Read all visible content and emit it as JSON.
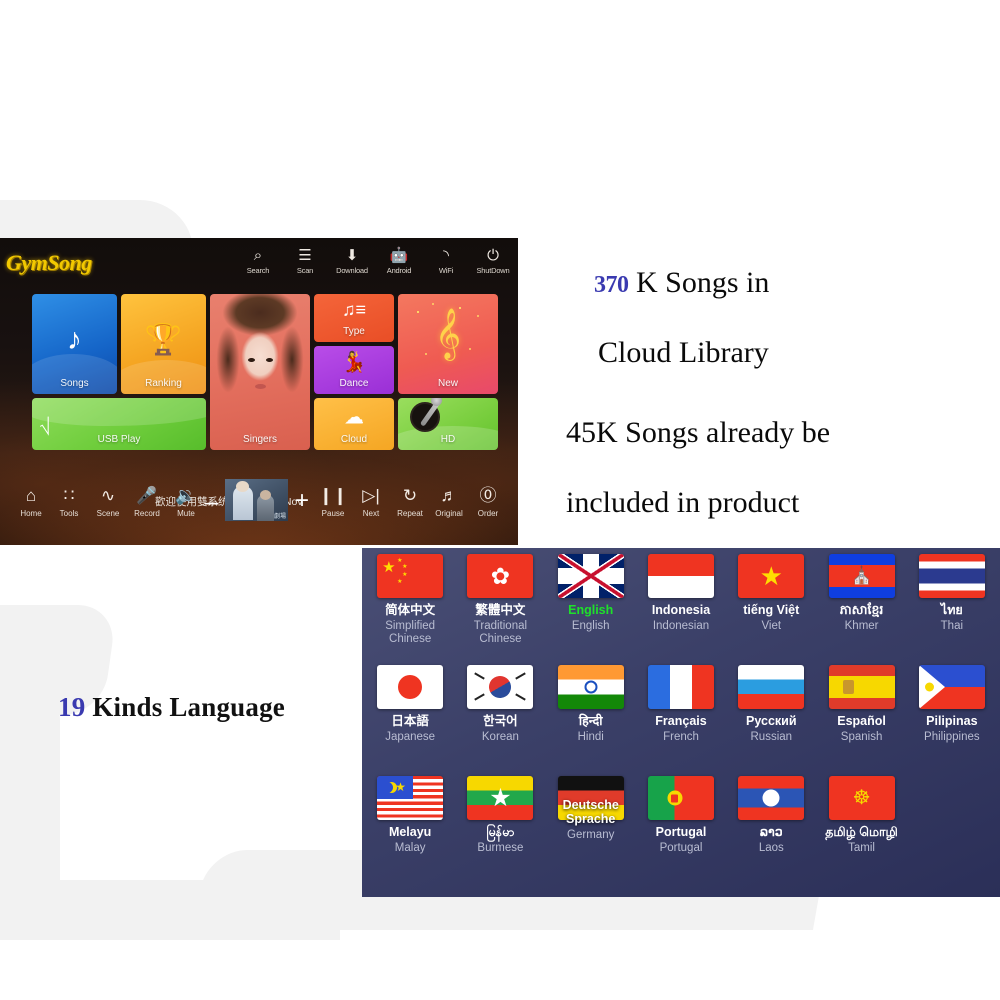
{
  "karaoke": {
    "brand": "GymSong",
    "welcome": "歡迎使用雙系统智能點歌機 Nov",
    "header_icons": [
      {
        "label": "Search",
        "icon": "search-icon",
        "glyph": "⌕"
      },
      {
        "label": "Scan",
        "icon": "scan-icon",
        "glyph": "☰"
      },
      {
        "label": "Download",
        "icon": "download-icon",
        "glyph": "⬇"
      },
      {
        "label": "Android",
        "icon": "android-icon",
        "glyph": "ᾑ6"
      },
      {
        "label": "WiFi",
        "icon": "wifi-icon",
        "glyph": "◝"
      },
      {
        "label": "ShutDown",
        "icon": "power-icon",
        "glyph": "⏻"
      }
    ],
    "tiles": [
      {
        "label": "Songs",
        "icon": "cloud-music-note-icon",
        "glyph": "♪",
        "color": "#1565c8"
      },
      {
        "label": "Ranking",
        "icon": "trophy-icon",
        "glyph": "Ἴ6",
        "color": "#f5a623"
      },
      {
        "label": "Singers",
        "icon": "singer-portrait",
        "glyph": "",
        "color": "#e4705f"
      },
      {
        "label": "Type",
        "icon": "music-list-icon",
        "glyph": "♫",
        "color": "#e94e26"
      },
      {
        "label": "Dance",
        "icon": "dancer-icon",
        "glyph": "Ὀ3",
        "color": "#9a2fd6"
      },
      {
        "label": "New",
        "icon": "treble-clef-icon",
        "glyph": "ᴑE",
        "color": "#ef5b52"
      },
      {
        "label": "USB Play",
        "icon": "usb-drive-icon",
        "glyph": "⌸",
        "color": "#6fcd3c"
      },
      {
        "label": "Cloud",
        "icon": "cloud-icon",
        "glyph": "☁",
        "color": "#f5a623"
      },
      {
        "label": "HD",
        "icon": "comedy-mic-icon",
        "glyph": "Ἲ4",
        "color": "#79ce3e"
      }
    ],
    "toolbar_left": [
      {
        "label": "Home",
        "icon": "home-icon",
        "glyph": "⌂"
      },
      {
        "label": "Tools",
        "icon": "tools-grid-icon",
        "glyph": "∷"
      },
      {
        "label": "Scene",
        "icon": "scene-icon",
        "glyph": "∿"
      },
      {
        "label": "Record",
        "icon": "microphone-icon",
        "glyph": "Ἲ4"
      },
      {
        "label": "Mute",
        "icon": "speaker-icon",
        "glyph": "ὐ9"
      }
    ],
    "toolbar_right": [
      {
        "label": "Pause",
        "icon": "pause-icon",
        "glyph": "⏸"
      },
      {
        "label": "Next",
        "icon": "next-track-icon",
        "glyph": "⏭"
      },
      {
        "label": "Repeat",
        "icon": "repeat-icon",
        "glyph": "↺"
      },
      {
        "label": "Original",
        "icon": "original-voice-icon",
        "glyph": "♬"
      },
      {
        "label": "Order",
        "icon": "order-count-icon",
        "glyph": "0"
      }
    ],
    "volume_minus": "–",
    "volume_plus": "+",
    "preview_caption": "劇場"
  },
  "marketing": {
    "line1_number": "370",
    "line1_rest": " K Songs in",
    "line2": "Cloud Library",
    "line3": "45K Songs already be",
    "line4": "included in product",
    "kinds_number": "19",
    "kinds_rest": " Kinds Language",
    "accent_color": "#3a3ab0"
  },
  "languages": [
    {
      "native": "简体中文",
      "english": "Simplified Chinese",
      "flag": "china-flag",
      "selected": false,
      "overlap": false
    },
    {
      "native": "繁體中文",
      "english": "Traditional Chinese",
      "flag": "hongkong-flag",
      "selected": false,
      "overlap": false
    },
    {
      "native": "English",
      "english": "English",
      "flag": "uk-flag",
      "selected": true,
      "overlap": false
    },
    {
      "native": "Indonesia",
      "english": "Indonesian",
      "flag": "indonesia-flag",
      "selected": false,
      "overlap": false
    },
    {
      "native": "tiếng Việt",
      "english": "Viet",
      "flag": "vietnam-flag",
      "selected": false,
      "overlap": false
    },
    {
      "native": "ភាសាខ្មែរ",
      "english": "Khmer",
      "flag": "cambodia-flag",
      "selected": false,
      "overlap": false
    },
    {
      "native": "ไทย",
      "english": "Thai",
      "flag": "thailand-flag",
      "selected": false,
      "overlap": false
    },
    {
      "native": "日本語",
      "english": "Japanese",
      "flag": "japan-flag",
      "selected": false,
      "overlap": false
    },
    {
      "native": "한국어",
      "english": "Korean",
      "flag": "korea-flag",
      "selected": false,
      "overlap": false
    },
    {
      "native": "हिन्दी",
      "english": "Hindi",
      "flag": "india-flag",
      "selected": false,
      "overlap": false
    },
    {
      "native": "Français",
      "english": "French",
      "flag": "france-flag",
      "selected": false,
      "overlap": false
    },
    {
      "native": "Русский",
      "english": "Russian",
      "flag": "russia-flag",
      "selected": false,
      "overlap": false
    },
    {
      "native": "Español",
      "english": "Spanish",
      "flag": "spain-flag",
      "selected": false,
      "overlap": false
    },
    {
      "native": "Pilipinas",
      "english": "Philippines",
      "flag": "philippines-flag",
      "selected": false,
      "overlap": false
    },
    {
      "native": "Melayu",
      "english": "Malay",
      "flag": "malaysia-flag",
      "selected": false,
      "overlap": false
    },
    {
      "native": "မြန်မာ",
      "english": "Burmese",
      "flag": "myanmar-flag",
      "selected": false,
      "overlap": false
    },
    {
      "native": "Deutsche Sprache",
      "english": "Germany",
      "flag": "germany-flag",
      "selected": false,
      "overlap": true
    },
    {
      "native": "Portugal",
      "english": "Portugal",
      "flag": "portugal-flag",
      "selected": false,
      "overlap": false
    },
    {
      "native": "ລາວ",
      "english": "Laos",
      "flag": "laos-flag",
      "selected": false,
      "overlap": false
    },
    {
      "native": "தமிழ் மொழி",
      "english": "Tamil",
      "flag": "tamil-flag",
      "selected": false,
      "overlap": false
    }
  ]
}
